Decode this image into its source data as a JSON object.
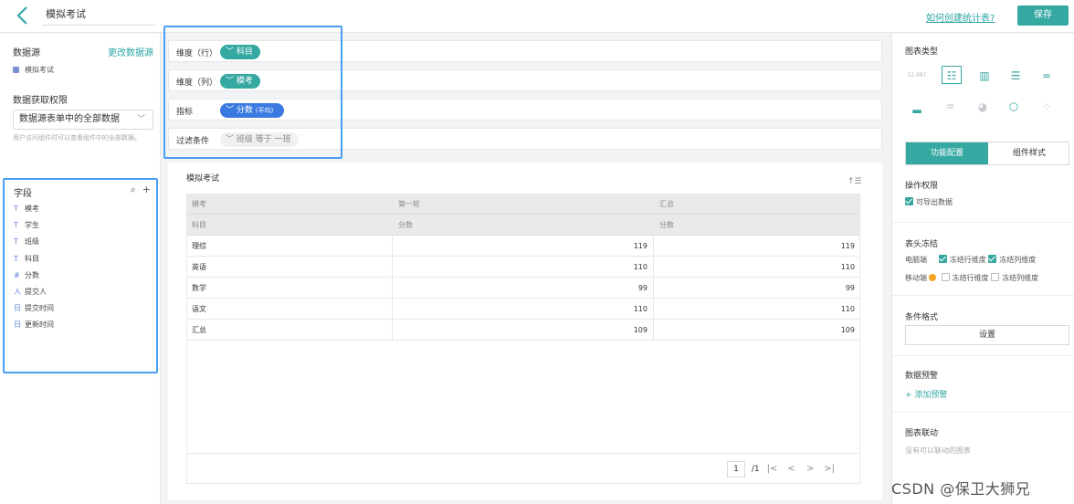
{
  "header": {
    "title": "模拟考试",
    "help_link": "如何创建统计表?",
    "save_label": "保存"
  },
  "left": {
    "datasource_label": "数据源",
    "change_datasource": "更改数据源",
    "datasource_item": "模拟考试",
    "permission_label": "数据获取权限",
    "permission_value": "数据源表单中的全部数据",
    "permission_hint": "用户访问组件时可以查看组件中的全部数据。",
    "fields_title": "字段",
    "fields": [
      {
        "type": "T",
        "name": "模考"
      },
      {
        "type": "T",
        "name": "学生"
      },
      {
        "type": "T",
        "name": "班级"
      },
      {
        "type": "T",
        "name": "科目"
      },
      {
        "type": "#",
        "name": "分数"
      },
      {
        "type": "人",
        "name": "提交人"
      },
      {
        "type": "日",
        "name": "提交时间"
      },
      {
        "type": "日",
        "name": "更新时间"
      }
    ]
  },
  "config": {
    "row_dim_label": "维度（行）",
    "row_dim_value": "科目",
    "col_dim_label": "维度（列）",
    "col_dim_value": "模考",
    "metric_label": "指标",
    "metric_value": "分数",
    "metric_agg": "(平均)",
    "filter_label": "过滤条件",
    "filter_value": "班级 等于 一班"
  },
  "preview": {
    "title": "模拟考试",
    "header1": [
      "模考",
      "第一轮",
      "汇总"
    ],
    "header2": [
      "科目",
      "分数",
      "分数"
    ],
    "rows": [
      [
        "理综",
        "119",
        "119"
      ],
      [
        "英语",
        "110",
        "110"
      ],
      [
        "数学",
        "99",
        "99"
      ],
      [
        "语文",
        "110",
        "110"
      ],
      [
        "汇总",
        "109",
        "109"
      ]
    ],
    "pager_page": "1",
    "pager_total": "/1"
  },
  "right": {
    "chart_type_title": "图表类型",
    "chart_type_number_label": "12,987",
    "tab_func": "功能配置",
    "tab_style": "组件样式",
    "op_perm_title": "操作权限",
    "export_label": "可导出数据",
    "freeze_title": "表头冻结",
    "pc_label": "电脑端",
    "mobile_label": "移动端",
    "freeze_row": "冻结行维度",
    "freeze_col": "冻结列维度",
    "cond_format_title": "条件格式",
    "set_label": "设置",
    "alert_title": "数据预警",
    "add_alert": "+ 添加预警",
    "link_title": "图表联动",
    "no_link": "没有可以联动的图表"
  },
  "watermark": "CSDN @保卫大狮兄",
  "colors": {
    "accent": "#35a8a2",
    "highlight": "#4a9ff5",
    "metric_pill": "#3a7ae0"
  }
}
